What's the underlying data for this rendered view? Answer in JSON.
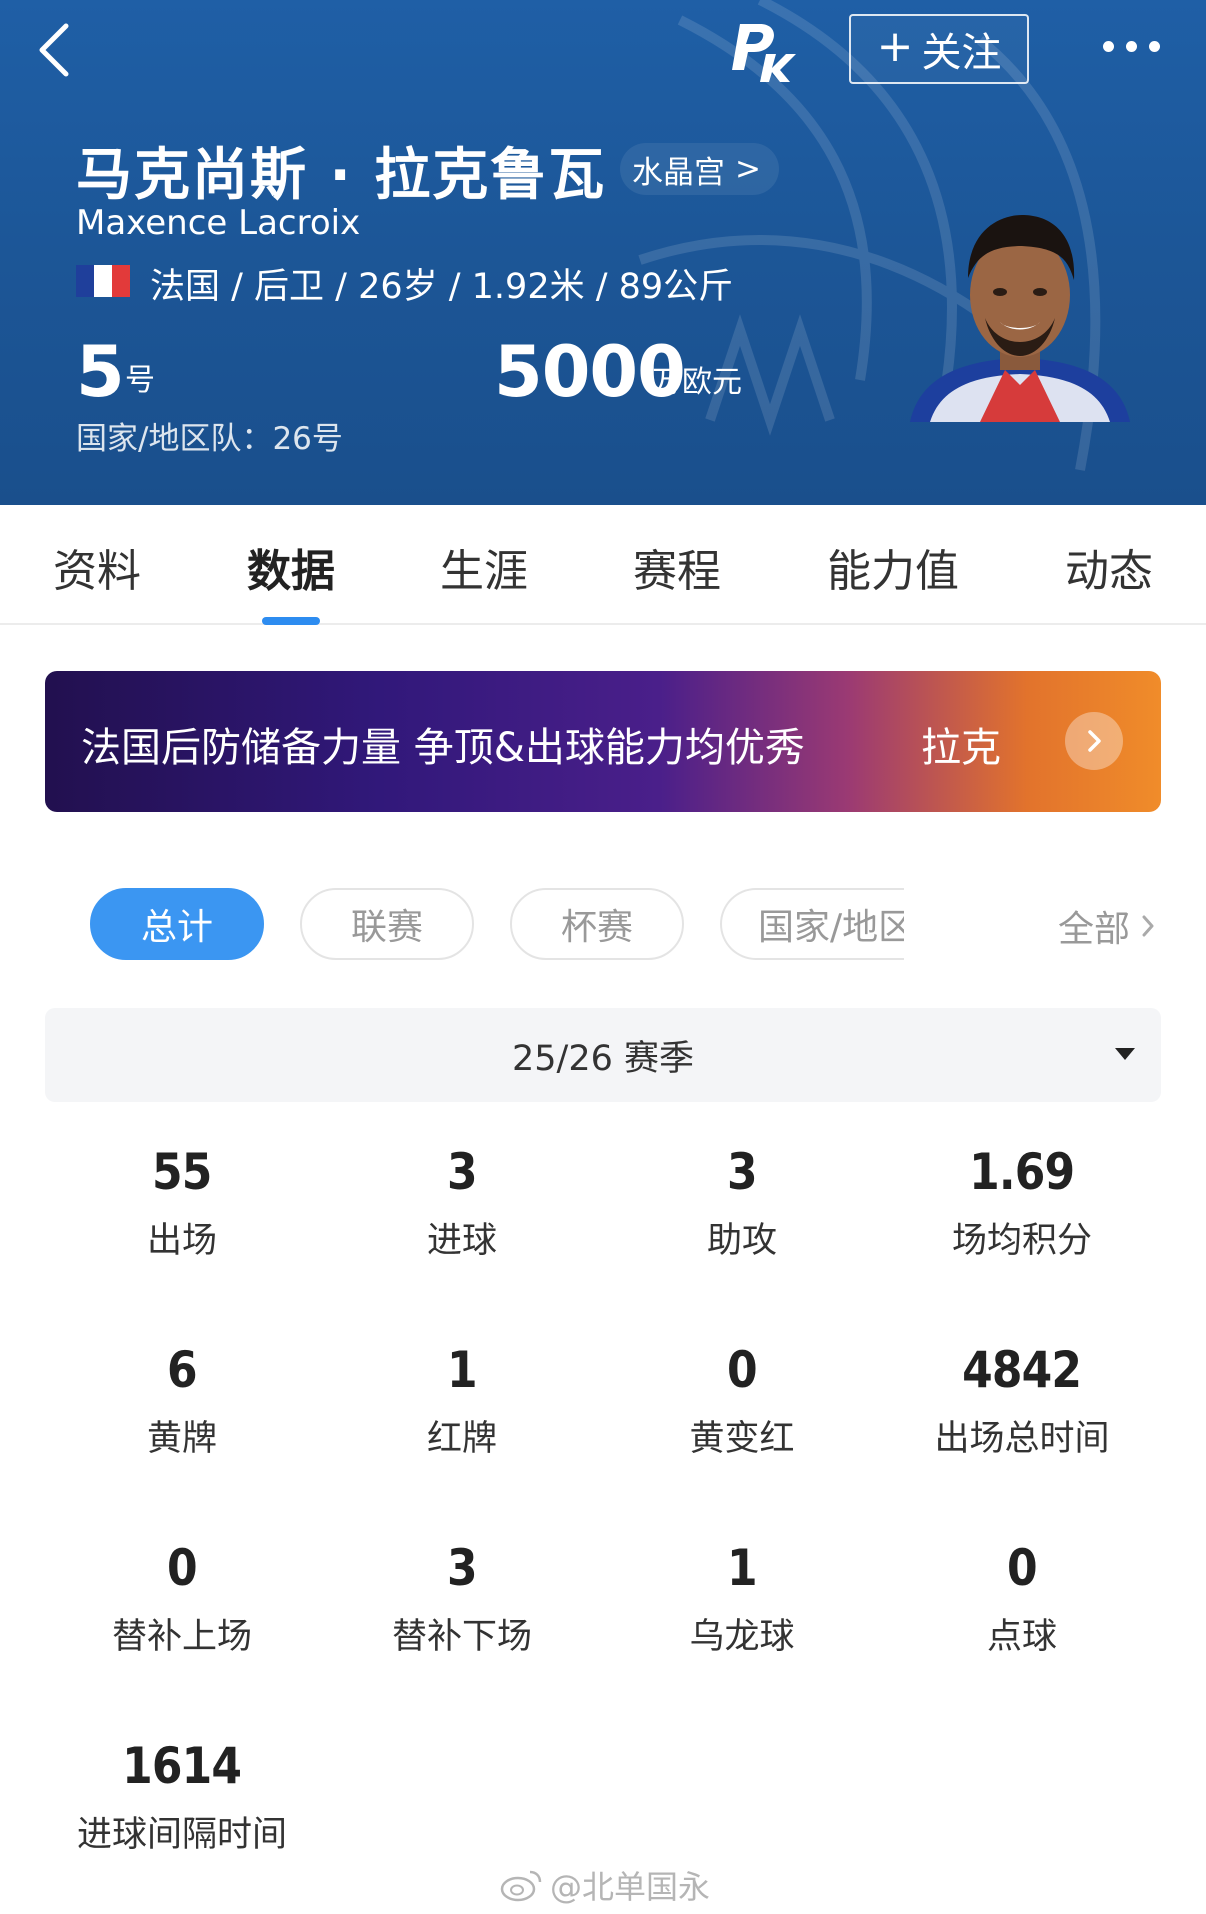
{
  "header": {
    "follow_label": "关注",
    "name_cn": "马克尚斯 · 拉克鲁瓦",
    "club": "水晶宫",
    "club_arrow": ">",
    "name_en": "Maxence Lacroix",
    "bio": "法国 / 后卫 / 26岁 / 1.92米 / 89公斤",
    "club_number": "5",
    "club_number_unit": "号",
    "market_value": "5000",
    "market_value_unit": "万欧元",
    "national_number": "国家/地区队：26号",
    "flag_colors": [
      "#1f3f9b",
      "#ffffff",
      "#e23a3a"
    ]
  },
  "tabs": [
    {
      "label": "资料"
    },
    {
      "label": "数据"
    },
    {
      "label": "生涯"
    },
    {
      "label": "赛程"
    },
    {
      "label": "能力值"
    },
    {
      "label": "动态"
    }
  ],
  "banner": {
    "text": "法国后防储备力量 争顶&出球能力均优秀",
    "name": "拉克"
  },
  "filters": {
    "chips": [
      {
        "label": "总计",
        "active": true
      },
      {
        "label": "联赛",
        "active": false
      },
      {
        "label": "杯赛",
        "active": false
      },
      {
        "label": "国家/地区",
        "active": false
      }
    ],
    "all_label": "全部"
  },
  "season": {
    "label": "25/26 赛季"
  },
  "stats": [
    {
      "value": "55",
      "label": "出场"
    },
    {
      "value": "3",
      "label": "进球"
    },
    {
      "value": "3",
      "label": "助攻"
    },
    {
      "value": "1.69",
      "label": "场均积分"
    },
    {
      "value": "6",
      "label": "黄牌"
    },
    {
      "value": "1",
      "label": "红牌"
    },
    {
      "value": "0",
      "label": "黄变红"
    },
    {
      "value": "4842",
      "label": "出场总时间"
    },
    {
      "value": "0",
      "label": "替补上场"
    },
    {
      "value": "3",
      "label": "替补下场"
    },
    {
      "value": "1",
      "label": "乌龙球"
    },
    {
      "value": "0",
      "label": "点球"
    },
    {
      "value": "1614",
      "label": "进球间隔时间"
    }
  ],
  "watermark": "@北单国永",
  "colors": {
    "header_bg": "#1c5697",
    "accent": "#2d8cf0",
    "chip_active": "#3b96f2"
  }
}
